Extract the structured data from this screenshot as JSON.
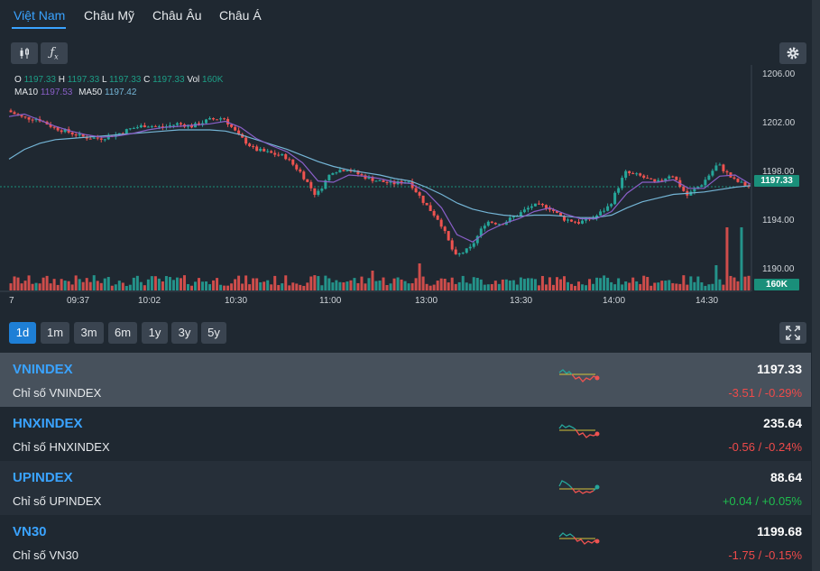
{
  "tabs": [
    {
      "label": "Việt Nam"
    },
    {
      "label": "Châu Mỹ"
    },
    {
      "label": "Châu Âu"
    },
    {
      "label": "Châu Á"
    }
  ],
  "legend": {
    "o_label": "O",
    "o_value": "1197.33",
    "h_label": "H",
    "h_value": "1197.33",
    "l_label": "L",
    "l_value": "1197.33",
    "c_label": "C",
    "c_value": "1197.33",
    "vol_label": "Vol",
    "vol_value": "160K",
    "ma10_label": "MA10",
    "ma10_value": "1197.53",
    "ma50_label": "MA50",
    "ma50_value": "1197.42"
  },
  "chart_data": {
    "type": "candlestick",
    "y_ticks": [
      "1206.00",
      "1202.00",
      "1198.00",
      "1194.00",
      "1190.00"
    ],
    "x_ticks": [
      "7",
      "09:37",
      "10:02",
      "10:30",
      "11:00",
      "13:00",
      "13:30",
      "14:00",
      "14:30"
    ],
    "last_price_label": "1197.33",
    "last_volume_label": "160K",
    "close_path": [
      1203.6,
      1203.0,
      1202.9,
      1202.2,
      1201.8,
      1201.4,
      1201.3,
      1201.6,
      1202.1,
      1202.4,
      1202.2,
      1202.5,
      1202.3,
      1202.8,
      1203.0,
      1201.5,
      1200.4,
      1200.1,
      1199.8,
      1198.5,
      1196.6,
      1198.6,
      1198.8,
      1198.2,
      1197.8,
      1197.6,
      1197.8,
      1196.0,
      1194.5,
      1191.6,
      1192.3,
      1194.5,
      1194.3,
      1195.0,
      1195.8,
      1195.7,
      1194.7,
      1194.4,
      1194.8,
      1195.8,
      1198.5,
      1198.2,
      1197.6,
      1198.4,
      1196.6,
      1197.6,
      1199.2,
      1197.9,
      1197.33
    ],
    "ma10_path": [
      1203.1,
      1203.3,
      1202.8,
      1202.3,
      1201.9,
      1201.6,
      1201.4,
      1201.5,
      1201.7,
      1202.0,
      1202.2,
      1202.3,
      1202.4,
      1202.5,
      1202.7,
      1202.2,
      1201.3,
      1200.7,
      1200.2,
      1199.3,
      1197.8,
      1197.7,
      1198.3,
      1198.2,
      1198.0,
      1197.7,
      1197.6,
      1196.9,
      1195.6,
      1193.4,
      1192.8,
      1193.7,
      1194.3,
      1194.7,
      1195.3,
      1195.6,
      1195.1,
      1194.7,
      1194.7,
      1195.3,
      1196.8,
      1197.7,
      1197.7,
      1197.9,
      1197.2,
      1197.2,
      1198.2,
      1198.3,
      1197.53
    ],
    "ma50_path": [
      1199.6,
      1200.4,
      1200.9,
      1201.2,
      1201.3,
      1201.4,
      1201.5,
      1201.6,
      1201.7,
      1201.8,
      1201.9,
      1202.0,
      1202.0,
      1202.0,
      1201.9,
      1201.6,
      1201.2,
      1200.8,
      1200.4,
      1199.9,
      1199.4,
      1199.0,
      1198.7,
      1198.5,
      1198.3,
      1198.0,
      1197.8,
      1197.3,
      1196.7,
      1196.0,
      1195.5,
      1195.2,
      1195.0,
      1194.9,
      1195.0,
      1195.0,
      1194.9,
      1194.8,
      1194.8,
      1195.0,
      1195.6,
      1196.1,
      1196.4,
      1196.7,
      1196.8,
      1196.9,
      1197.1,
      1197.3,
      1197.42
    ]
  },
  "ranges": [
    {
      "label": "1d"
    },
    {
      "label": "1m"
    },
    {
      "label": "3m"
    },
    {
      "label": "6m"
    },
    {
      "label": "1y"
    },
    {
      "label": "3y"
    },
    {
      "label": "5y"
    }
  ],
  "indices": [
    {
      "name": "VNINDEX",
      "sub": "Chỉ số VNINDEX",
      "price": "1197.33",
      "change": "-3.51 / -0.29%",
      "direction": "down"
    },
    {
      "name": "HNXINDEX",
      "sub": "Chỉ số HNXINDEX",
      "price": "235.64",
      "change": "-0.56 / -0.24%",
      "direction": "down"
    },
    {
      "name": "UPINDEX",
      "sub": "Chỉ số UPINDEX",
      "price": "88.64",
      "change": "+0.04 / +0.05%",
      "direction": "up"
    },
    {
      "name": "VN30",
      "sub": "Chỉ số VN30",
      "price": "1199.68",
      "change": "-1.75 / -0.15%",
      "direction": "down"
    }
  ],
  "colors": {
    "up": "#26a69a",
    "down": "#ef5350",
    "ma10": "#8a5fc8",
    "ma50": "#74b5d6",
    "accent": "#3aa3ff"
  },
  "icons": {
    "candles": "candlestick-icon",
    "indicator": "fx-icon",
    "settings": "gear-icon",
    "fullscreen": "expand-icon"
  }
}
